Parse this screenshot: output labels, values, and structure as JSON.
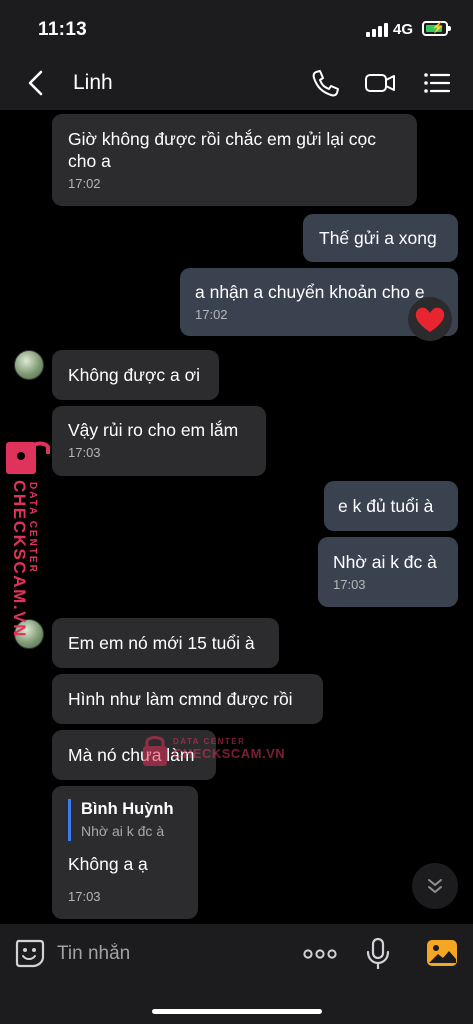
{
  "status": {
    "time": "11:13",
    "network": "4G"
  },
  "header": {
    "contact_name": "Linh"
  },
  "messages": [
    {
      "text": "Giờ không được rồi chắc em gửi lại cọc cho a",
      "time": "17:02"
    },
    {
      "text": "Thế gửi a xong"
    },
    {
      "text": "a nhận a chuyển khoản cho e",
      "time": "17:02",
      "reaction": "heart"
    },
    {
      "text": "Không được a ơi"
    },
    {
      "text": "Vậy rủi ro cho em lắm",
      "time": "17:03"
    },
    {
      "text": "e k đủ tuổi à"
    },
    {
      "text": "Nhờ ai k đc à",
      "time": "17:03"
    },
    {
      "text": "Em em nó mới 15 tuổi à"
    },
    {
      "text": "Hình như làm cmnd được rồi"
    },
    {
      "text": "Mà nó chưa làm"
    },
    {
      "quote_name": "Bình Huỳnh",
      "quote_text": "Nhờ ai k đc à",
      "text": "Không a ạ",
      "time": "17:03"
    }
  ],
  "watermark": {
    "label": "DATA CENTER",
    "brand": "CHECKSCAM.VN"
  },
  "composer": {
    "placeholder": "Tin nhắn"
  },
  "colors": {
    "incoming": "#2c2c2e",
    "outgoing": "#3a4250",
    "accent": "#3a7bf0",
    "watermark": "#e0335b"
  },
  "icons": [
    "back-arrow",
    "phone",
    "video-camera",
    "list-menu",
    "heart",
    "emoji",
    "more-dots",
    "microphone",
    "photo-gallery",
    "chevrons-down"
  ]
}
